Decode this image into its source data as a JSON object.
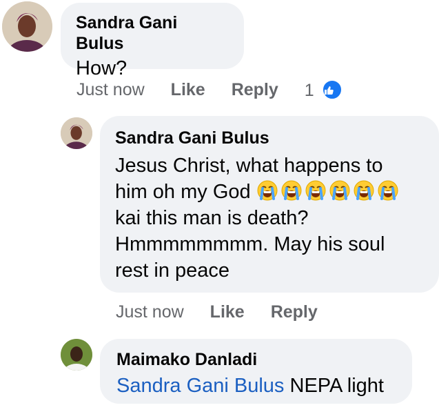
{
  "comments": [
    {
      "author": "Sandra Gani Bulus",
      "text": "How?",
      "time": "Just now",
      "like_label": "Like",
      "reply_label": "Reply",
      "reaction_count": "1"
    },
    {
      "author": "Sandra Gani Bulus",
      "text_line1": "Jesus Christ, what happens to",
      "text_line2": "him oh my God",
      "emoji_name": "loudly-crying-face",
      "emoji_count": 6,
      "text_line3": "kai this man is death?",
      "text_line4": "Hmmmmmmmm. May his soul",
      "text_line5": "rest in peace",
      "time": "Just now",
      "like_label": "Like",
      "reply_label": "Reply"
    },
    {
      "author": "Maimako Danladi",
      "mention": "Sandra Gani Bulus",
      "text": "NEPA light"
    }
  ],
  "colors": {
    "bubble": "#f0f2f5",
    "mention": "#1b5fc1",
    "meta": "#65676b",
    "like_badge": "#1877f2"
  }
}
